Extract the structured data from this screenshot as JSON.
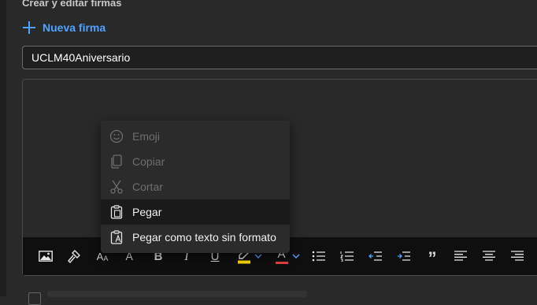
{
  "section": {
    "title": "Crear y editar firmas"
  },
  "new_signature": {
    "label": "Nueva firma",
    "icon": "plus-icon"
  },
  "signature_name": {
    "value": "UCLM40Aniversario"
  },
  "context_menu": {
    "items": [
      {
        "label": "Emoji",
        "icon": "emoji-icon",
        "enabled": false
      },
      {
        "label": "Copiar",
        "icon": "copy-icon",
        "enabled": false
      },
      {
        "label": "Cortar",
        "icon": "cut-icon",
        "enabled": false
      },
      {
        "label": "Pegar",
        "icon": "paste-icon",
        "enabled": true,
        "highlighted": true
      },
      {
        "label": "Pegar como texto sin formato",
        "icon": "paste-plain-text-icon",
        "enabled": true
      }
    ]
  },
  "toolbar": {
    "items": [
      "insert-picture-icon",
      "format-painter-icon",
      "font-size-decrease-icon",
      "font-size-increase-icon",
      "bold-icon",
      "italic-icon",
      "underline-icon",
      "highlight-icon",
      "font-color-icon",
      "bullets-icon",
      "numbering-icon",
      "decrease-indent-icon",
      "increase-indent-icon",
      "quote-icon",
      "align-left-icon",
      "align-center-icon",
      "align-right-icon"
    ],
    "glyphs": {
      "font_shrink": "A",
      "font_grow": "A",
      "bold": "B",
      "italic": "I",
      "underline": "U",
      "font_color": "A",
      "quote": "”"
    },
    "colors": {
      "highlight": "#ffd800",
      "font_color": "#e8413b",
      "accent": "#4fa3ff"
    }
  }
}
